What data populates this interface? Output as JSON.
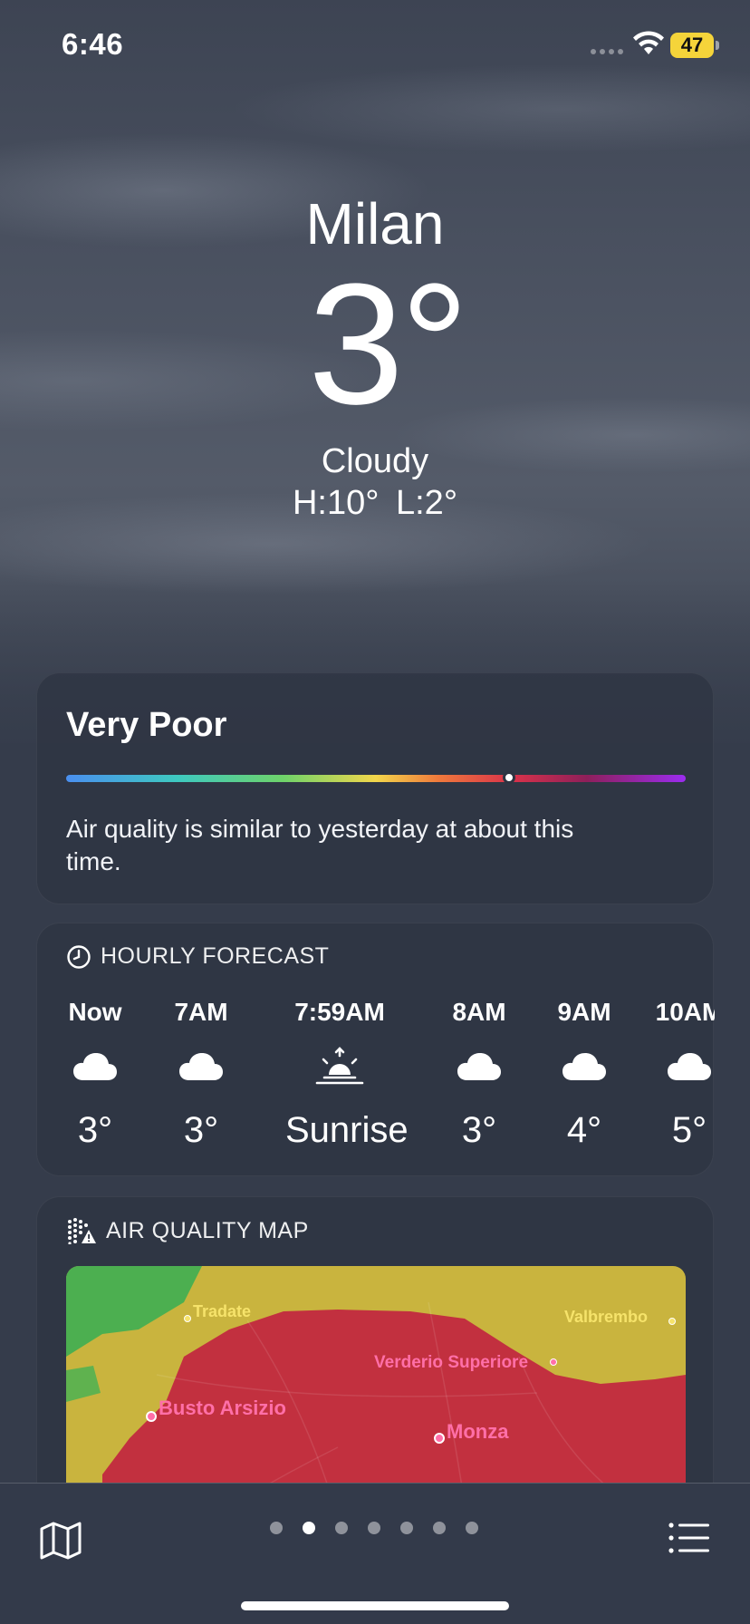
{
  "status_bar": {
    "time": "6:46",
    "battery": "47"
  },
  "location": {
    "city": "Milan",
    "temperature": "3°",
    "condition": "Cloudy",
    "high_low": "H:10°  L:2°"
  },
  "air_quality": {
    "category": "Very Poor",
    "description": "Air quality is similar to yesterday at about this time.",
    "scale_position": 0.715
  },
  "hourly": {
    "title": "HOURLY FORECAST",
    "items": [
      {
        "label": "Now",
        "icon": "cloud-icon",
        "value": "3°"
      },
      {
        "label": "7AM",
        "icon": "cloud-icon",
        "value": "3°"
      },
      {
        "label": "7:59AM",
        "icon": "sunrise-icon",
        "value": "Sunrise"
      },
      {
        "label": "8AM",
        "icon": "cloud-icon",
        "value": "3°"
      },
      {
        "label": "9AM",
        "icon": "cloud-icon",
        "value": "4°"
      },
      {
        "label": "10AM",
        "icon": "cloud-icon",
        "value": "5°"
      }
    ]
  },
  "aq_map": {
    "title": "AIR QUALITY MAP",
    "places": {
      "tradate": "Tradate",
      "valbrembo": "Valbrembo",
      "verderio": "Verderio Superiore",
      "busto": "Busto Arsizio",
      "monza": "Monza"
    }
  },
  "pager": {
    "count": 7,
    "active_index": 1
  },
  "colors": {
    "aqi_yellow": "#c9b43e",
    "aqi_green": "#4caf50",
    "aqi_red": "#c2303f",
    "aqi_dark": "#5a1e2a",
    "pink_label": "#ff6fa8",
    "yellow_label": "#f6e36a"
  }
}
